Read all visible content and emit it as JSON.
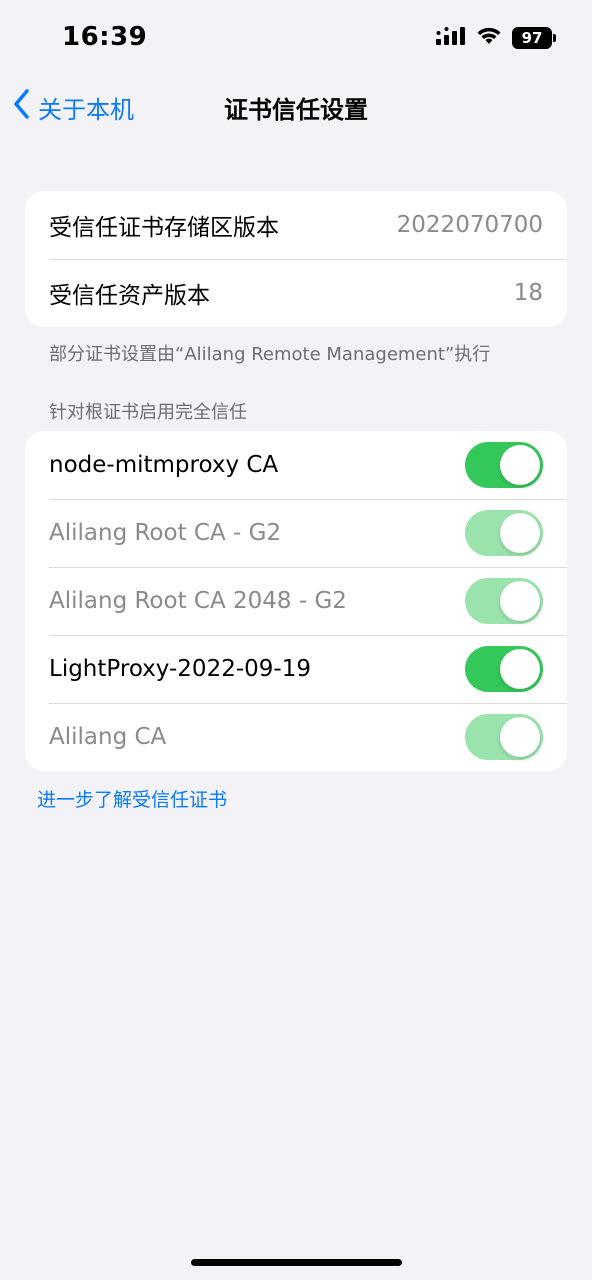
{
  "status_bar": {
    "time": "16:39",
    "battery": "97",
    "icons": [
      "cellular-signal-icon",
      "wifi-icon",
      "battery-icon"
    ]
  },
  "nav": {
    "back_label": "关于本机",
    "title": "证书信任设置"
  },
  "versions": {
    "rows": [
      {
        "label": "受信任证书存储区版本",
        "value": "2022070700"
      },
      {
        "label": "受信任资产版本",
        "value": "18"
      }
    ],
    "footnote": "部分证书设置由“Alilang Remote Management”执行"
  },
  "trust_section": {
    "header": "针对根证书启用完全信任",
    "items": [
      {
        "label": "node-mitmproxy CA",
        "enabled": true,
        "editable": true
      },
      {
        "label": "Alilang Root CA - G2",
        "enabled": true,
        "editable": false
      },
      {
        "label": "Alilang Root CA 2048 - G2",
        "enabled": true,
        "editable": false
      },
      {
        "label": "LightProxy-2022-09-19",
        "enabled": true,
        "editable": true
      },
      {
        "label": "Alilang CA",
        "enabled": true,
        "editable": false
      }
    ]
  },
  "learn_more_link": "进一步了解受信任证书",
  "colors": {
    "accent": "#0a7aff",
    "toggle_on": "#34c759",
    "toggle_on_disabled": "#9ae3ac",
    "background": "#f2f2f7"
  }
}
